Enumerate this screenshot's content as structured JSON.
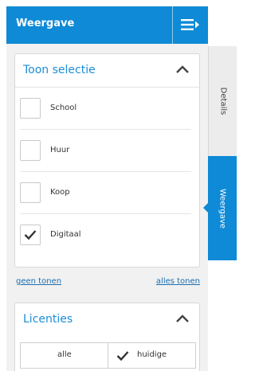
{
  "panel": {
    "title": "Weergave",
    "menu_icon": "list-collapse-icon",
    "accent": "#0e8ad6"
  },
  "selection": {
    "title": "Toon selectie",
    "collapse_icon": "chevron-up-icon",
    "options": [
      {
        "label": "School",
        "checked": false
      },
      {
        "label": "Huur",
        "checked": false
      },
      {
        "label": "Koop",
        "checked": false
      },
      {
        "label": "Digitaal",
        "checked": true
      }
    ],
    "show_none": "geen tonen",
    "show_all": "alles tonen"
  },
  "licenses": {
    "title": "Licenties",
    "collapse_icon": "chevron-up-icon",
    "segments": [
      {
        "label": "alle",
        "selected": false
      },
      {
        "label": "huidige",
        "selected": true
      }
    ]
  },
  "side_tabs": {
    "details": "Details",
    "weergave": "Weergave",
    "active": "Weergave"
  }
}
